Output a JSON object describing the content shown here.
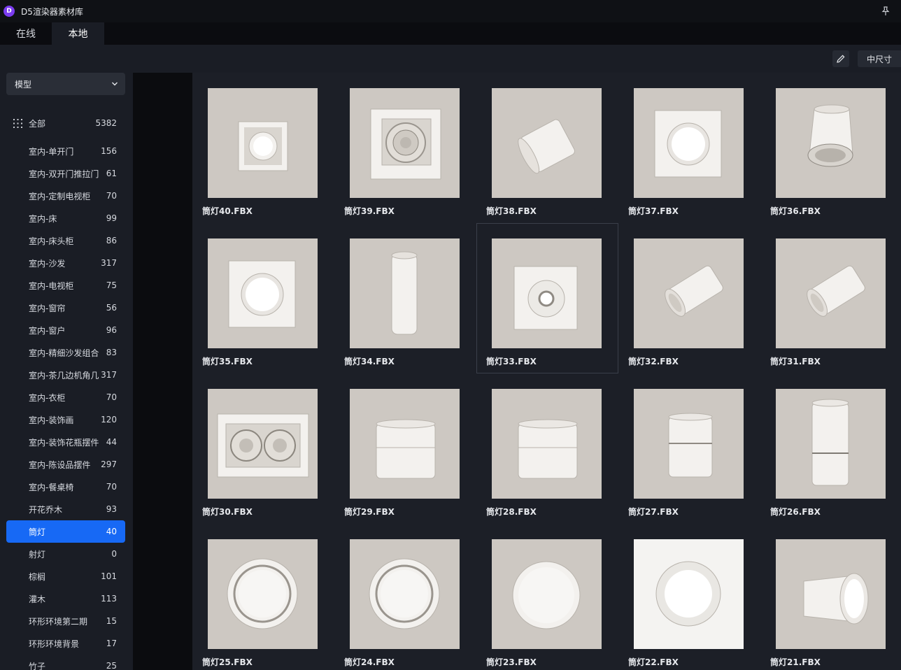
{
  "app": {
    "title": "D5渲染器素材库",
    "logo_letter": "D"
  },
  "tabs": [
    {
      "label": "在线"
    },
    {
      "label": "本地"
    }
  ],
  "toolbar": {
    "size_label": "中尺寸"
  },
  "sidebar": {
    "dropdown": "模型",
    "all": {
      "label": "全部",
      "count": "5382"
    },
    "items": [
      {
        "label": "室内-单开门",
        "count": "156"
      },
      {
        "label": "室内-双开门推拉门",
        "count": "61"
      },
      {
        "label": "室内-定制电视柜",
        "count": "70"
      },
      {
        "label": "室内-床",
        "count": "99"
      },
      {
        "label": "室内-床头柜",
        "count": "86"
      },
      {
        "label": "室内-沙发",
        "count": "317"
      },
      {
        "label": "室内-电视柜",
        "count": "75"
      },
      {
        "label": "室内-窗帘",
        "count": "56"
      },
      {
        "label": "室内-窗户",
        "count": "96"
      },
      {
        "label": "室内-精细沙发组合",
        "count": "83"
      },
      {
        "label": "室内-茶几边机角几",
        "count": "317"
      },
      {
        "label": "室内-衣柜",
        "count": "70"
      },
      {
        "label": "室内-装饰画",
        "count": "120"
      },
      {
        "label": "室内-装饰花瓶摆件",
        "count": "44"
      },
      {
        "label": "室内-陈设品摆件",
        "count": "297"
      },
      {
        "label": "室内-餐桌椅",
        "count": "70"
      },
      {
        "label": "开花乔木",
        "count": "93"
      },
      {
        "label": "筒灯",
        "count": "40"
      },
      {
        "label": "射灯",
        "count": "0"
      },
      {
        "label": "棕榈",
        "count": "101"
      },
      {
        "label": "灌木",
        "count": "113"
      },
      {
        "label": "环形环境第二期",
        "count": "15"
      },
      {
        "label": "环形环境背景",
        "count": "17"
      },
      {
        "label": "竹子",
        "count": "25"
      }
    ],
    "active_index": 17
  },
  "assets": [
    {
      "name": "筒灯40.FBX",
      "icon": "square-recessed-downlight"
    },
    {
      "name": "筒灯39.FBX",
      "icon": "square-grille-downlight"
    },
    {
      "name": "筒灯38.FBX",
      "icon": "angled-cylinder-light"
    },
    {
      "name": "筒灯37.FBX",
      "icon": "square-round-downlight"
    },
    {
      "name": "筒灯36.FBX",
      "icon": "cylinder-heatsink-light"
    },
    {
      "name": "筒灯35.FBX",
      "icon": "square-round-downlight"
    },
    {
      "name": "筒灯34.FBX",
      "icon": "vertical-tube-light"
    },
    {
      "name": "筒灯33.FBX",
      "icon": "square-ring-downlight"
    },
    {
      "name": "筒灯32.FBX",
      "icon": "tilted-spot-light"
    },
    {
      "name": "筒灯31.FBX",
      "icon": "tilted-spot-light"
    },
    {
      "name": "筒灯30.FBX",
      "icon": "double-grille-downlight"
    },
    {
      "name": "筒灯29.FBX",
      "icon": "wide-cylinder-light"
    },
    {
      "name": "筒灯28.FBX",
      "icon": "wide-cylinder-light"
    },
    {
      "name": "筒灯27.FBX",
      "icon": "short-cylinder-light"
    },
    {
      "name": "筒灯26.FBX",
      "icon": "tall-cylinder-light"
    },
    {
      "name": "筒灯25.FBX",
      "icon": "round-ring-downlight"
    },
    {
      "name": "筒灯24.FBX",
      "icon": "round-ring-downlight"
    },
    {
      "name": "筒灯23.FBX",
      "icon": "round-flat-downlight"
    },
    {
      "name": "筒灯22.FBX",
      "icon": "round-white-ring"
    },
    {
      "name": "筒灯21.FBX",
      "icon": "side-cylinder-light"
    }
  ],
  "colors": {
    "accent": "#1769f5",
    "thumb_bg": "#cdc8c2",
    "fixture": "#f1efec"
  }
}
